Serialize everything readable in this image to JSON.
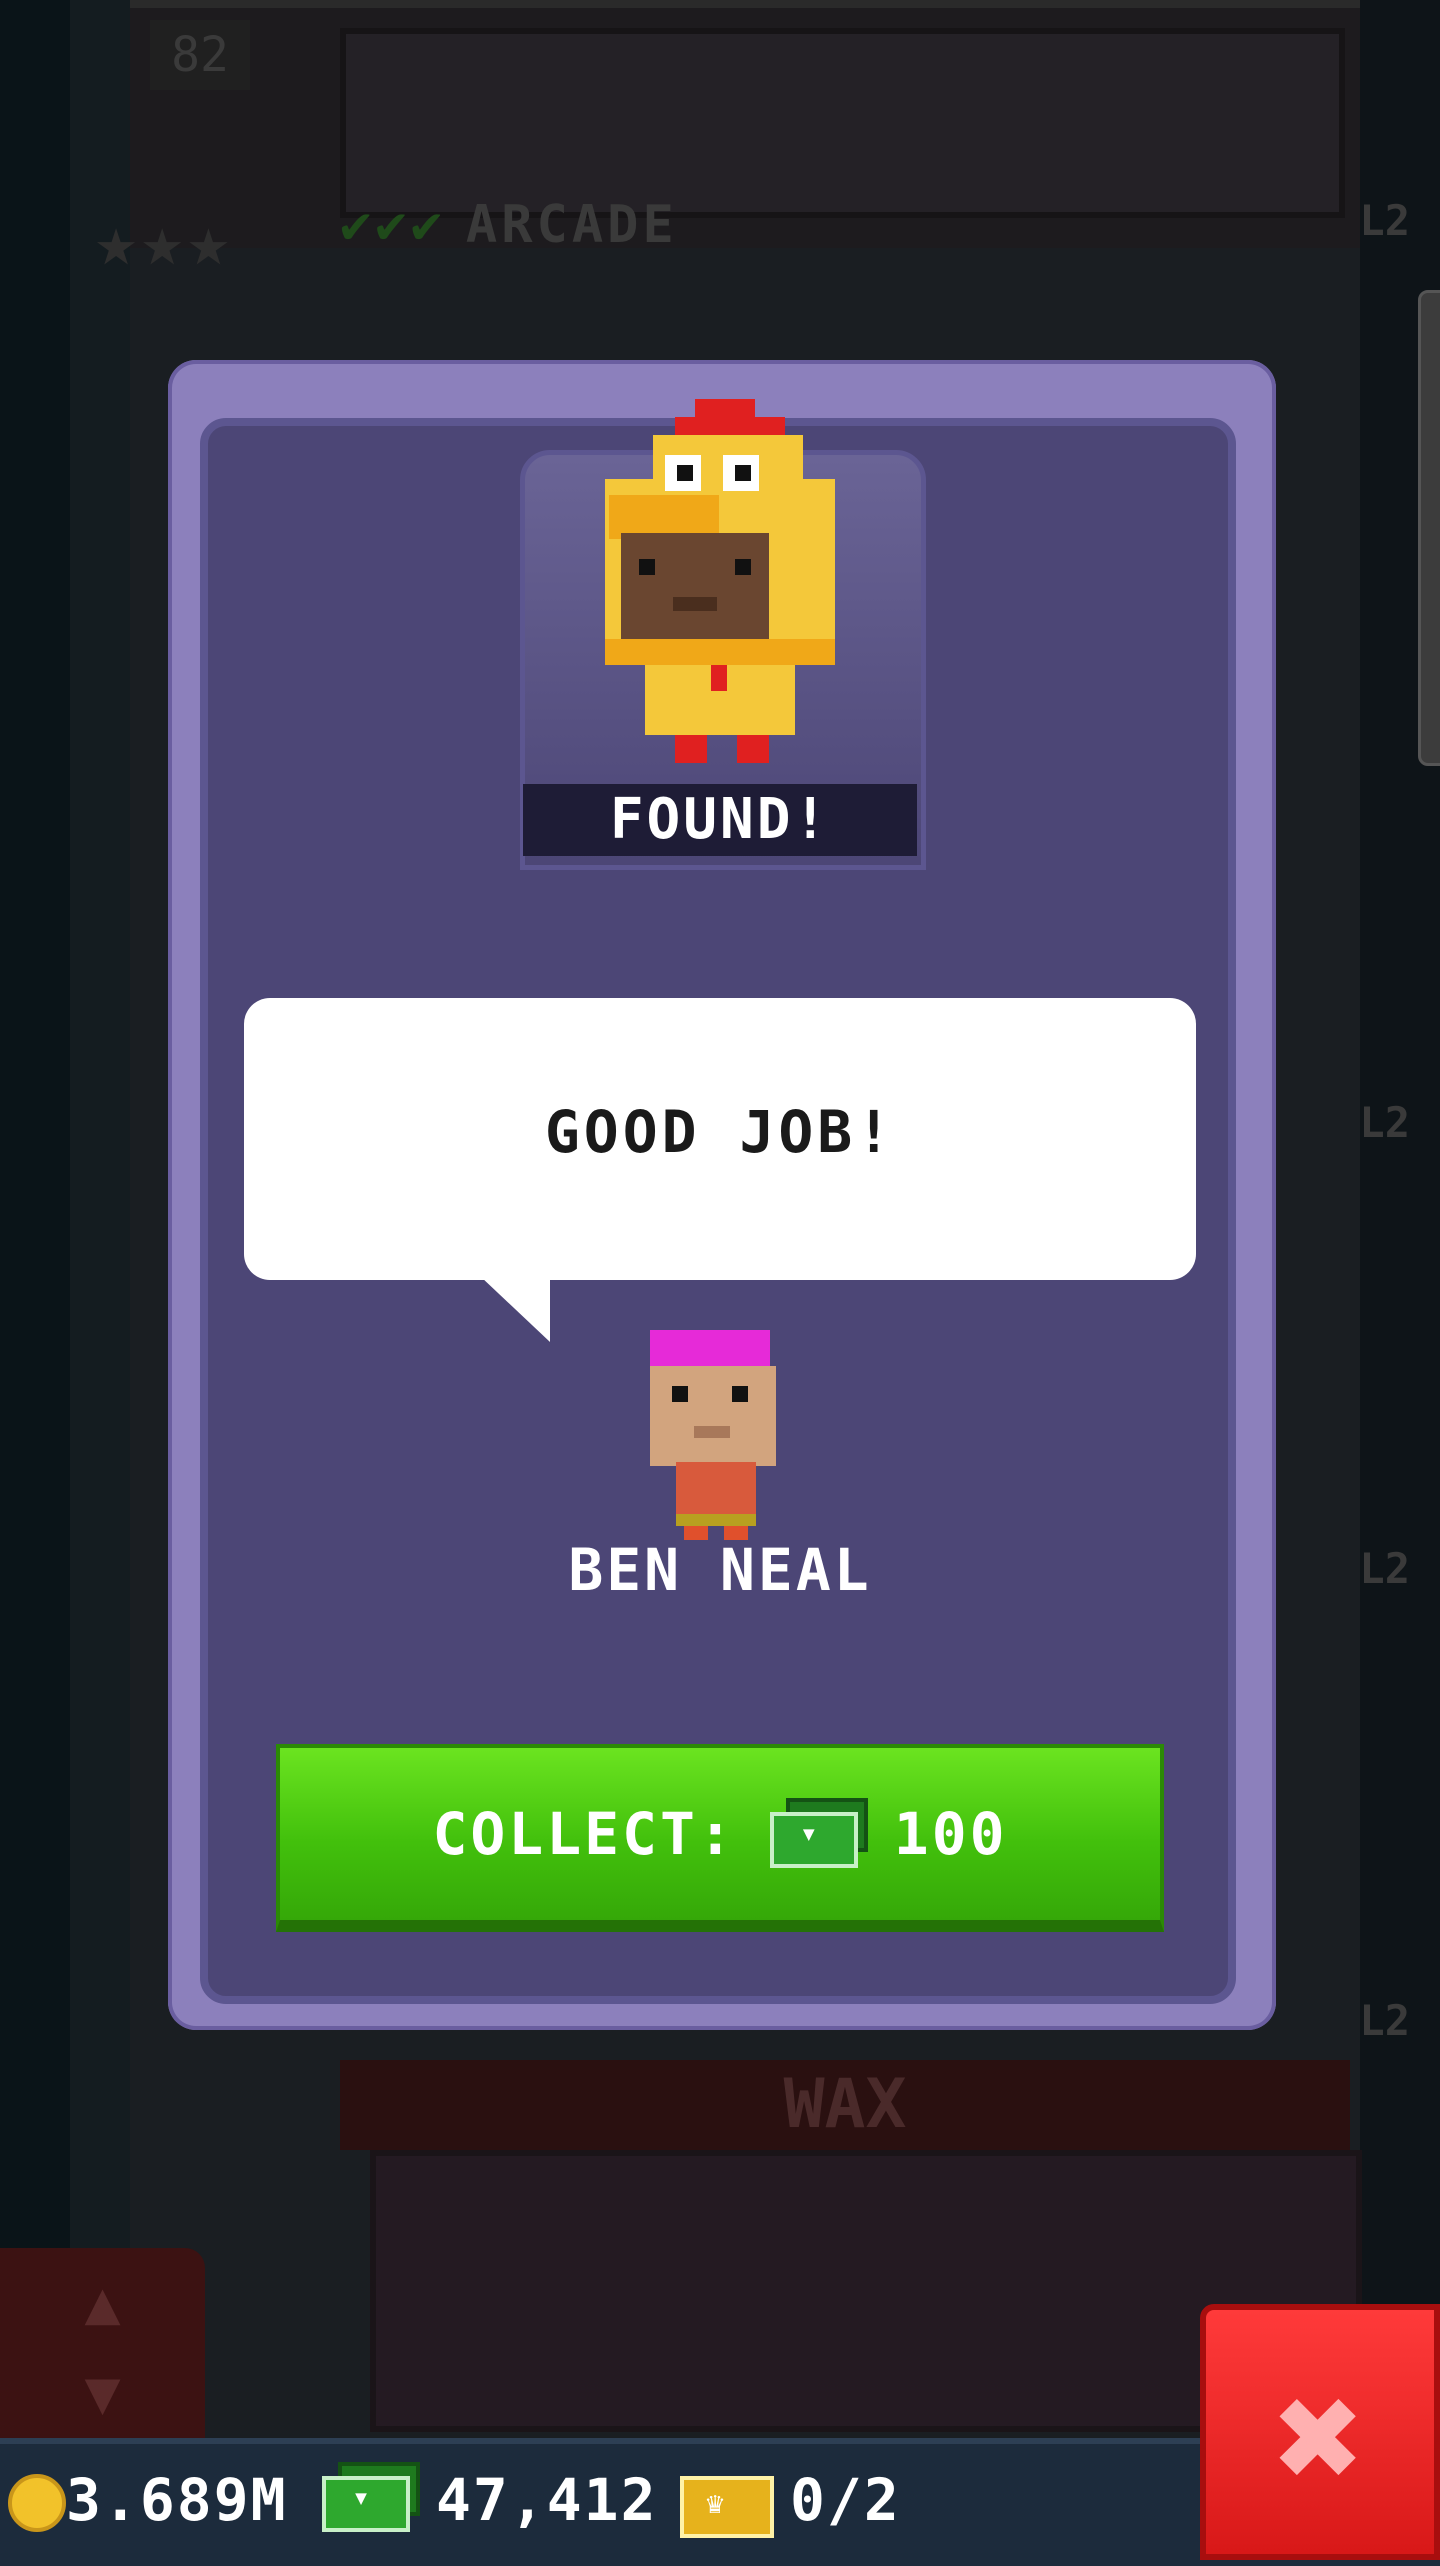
{
  "background": {
    "elevator_floor_number": "82",
    "floor_name": "ARCADE",
    "level_badges": [
      "L2",
      "L2",
      "L2",
      "L2"
    ],
    "wax_sign": "WAX"
  },
  "dialog": {
    "found_label": "FOUND!",
    "speech": "GOOD JOB!",
    "npc_name": "BEN NEAL",
    "collect": {
      "label": "COLLECT:",
      "amount": "100"
    }
  },
  "status_bar": {
    "coins": "3.689M",
    "bux": "47,412",
    "vip": "0/2"
  },
  "icons": {
    "coin": "coin-icon",
    "bux": "tower-bux-icon",
    "vip": "vip-ticket-icon",
    "close": "close-x-icon",
    "elevator": "elevator-arrows-icon"
  },
  "colors": {
    "dialog_bg": "#4c4676",
    "collect_green": "#42c00c",
    "close_red": "#d81818",
    "status_bar": "#1c2b3c"
  }
}
